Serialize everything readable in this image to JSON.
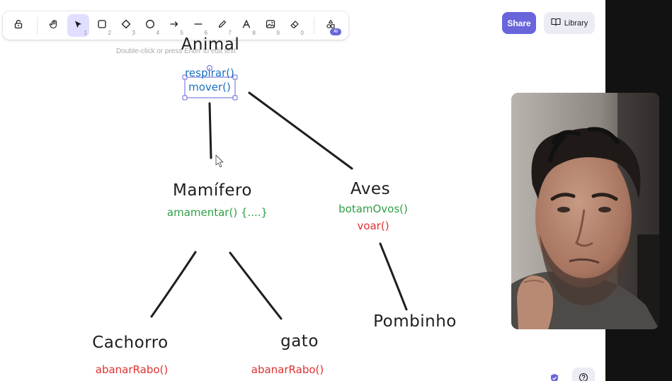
{
  "toolbar": {
    "tools": [
      {
        "name": "lock-tool",
        "icon": "lock-icon",
        "glyph": "🔓",
        "shortcut": ""
      },
      {
        "name": "hand-tool",
        "icon": "hand-icon",
        "glyph": "✋",
        "shortcut": ""
      },
      {
        "name": "selection-tool",
        "icon": "pointer-icon",
        "glyph": "➤",
        "shortcut": "1",
        "active": true
      },
      {
        "name": "rectangle-tool",
        "icon": "rectangle-icon",
        "glyph": "□",
        "shortcut": "2"
      },
      {
        "name": "diamond-tool",
        "icon": "diamond-icon",
        "glyph": "◇",
        "shortcut": "3"
      },
      {
        "name": "ellipse-tool",
        "icon": "ellipse-icon",
        "glyph": "○",
        "shortcut": "4"
      },
      {
        "name": "arrow-tool",
        "icon": "arrow-icon",
        "glyph": "→",
        "shortcut": "5"
      },
      {
        "name": "line-tool",
        "icon": "line-icon",
        "glyph": "—",
        "shortcut": "6"
      },
      {
        "name": "draw-tool",
        "icon": "pencil-icon",
        "glyph": "✎",
        "shortcut": "7"
      },
      {
        "name": "text-tool",
        "icon": "text-icon",
        "glyph": "A",
        "shortcut": "8"
      },
      {
        "name": "image-tool",
        "icon": "image-icon",
        "glyph": "▣",
        "shortcut": "9"
      },
      {
        "name": "eraser-tool",
        "icon": "eraser-icon",
        "glyph": "⌫",
        "shortcut": "0"
      }
    ],
    "extra_tools": {
      "icon": "shapes-icon",
      "glyph": "⌂",
      "badge": "AI"
    }
  },
  "hint": "Double-click or press Enter to edit text",
  "share_label": "Share",
  "library_label": "Library",
  "diagram": {
    "animal": {
      "title": "Animal",
      "methods": [
        "respirar()",
        "mover()"
      ]
    },
    "mamifero": {
      "title": "Mamífero",
      "methods": [
        "amamentar() {....}"
      ]
    },
    "aves": {
      "title": "Aves",
      "methods": [
        "botamOvos()",
        "voar()"
      ]
    },
    "cachorro": {
      "title": "Cachorro",
      "methods": [
        "abanarRabo()"
      ]
    },
    "gato": {
      "title": "gato",
      "methods": [
        "abanarRabo()"
      ]
    },
    "pombinho": {
      "title": "Pombinho",
      "methods": []
    }
  },
  "colors": {
    "accent": "#6965db",
    "method_blue": "#1971c2",
    "method_green": "#2f9e44",
    "method_red": "#e03131",
    "stroke": "#1e1e1e"
  },
  "bottom_icons": [
    {
      "name": "shield-check-icon",
      "glyph": "✔"
    },
    {
      "name": "help-icon",
      "glyph": "?"
    }
  ]
}
